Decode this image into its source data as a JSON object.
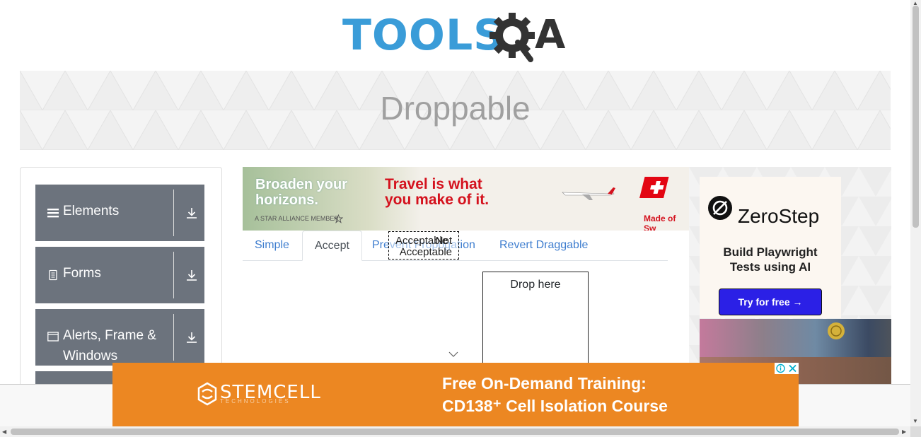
{
  "header": {
    "logo_text": "TOOLS",
    "logo_a": "A"
  },
  "page": {
    "title": "Droppable"
  },
  "sidebar": {
    "groups": [
      {
        "label": "Elements",
        "icon": "menu-lines-icon"
      },
      {
        "label": "Forms",
        "icon": "document-icon"
      },
      {
        "label": "Alerts, Frame &",
        "label2": "Windows",
        "icon": "window-icon"
      }
    ]
  },
  "ads": {
    "top": {
      "line1": "Broaden your",
      "line2": "horizons.",
      "tag1": "Travel is what",
      "tag2": "you make of it.",
      "alliance": "A STAR ALLIANCE MEMBER",
      "made": "Made of Sw"
    },
    "right": {
      "brand": "ZeroStep",
      "sub1": "Build Playwright",
      "sub2": "Tests using AI",
      "cta": "Try for free →"
    },
    "bottom": {
      "brand": "STEMCELL",
      "brand_sub": "TECHNOLOGIES",
      "head1": "Free On-Demand Training:",
      "head2": "CD138⁺ Cell Isolation Course"
    }
  },
  "tabs": [
    {
      "label": "Simple",
      "active": false
    },
    {
      "label": "Accept",
      "active": true
    },
    {
      "label": "Prevent Propogation",
      "active": false
    },
    {
      "label": "Revert Draggable",
      "active": false
    }
  ],
  "draggables": {
    "acceptable": "Acceptable",
    "not_acceptable": "Not Acceptable"
  },
  "drop_target": {
    "label": "Drop here"
  }
}
